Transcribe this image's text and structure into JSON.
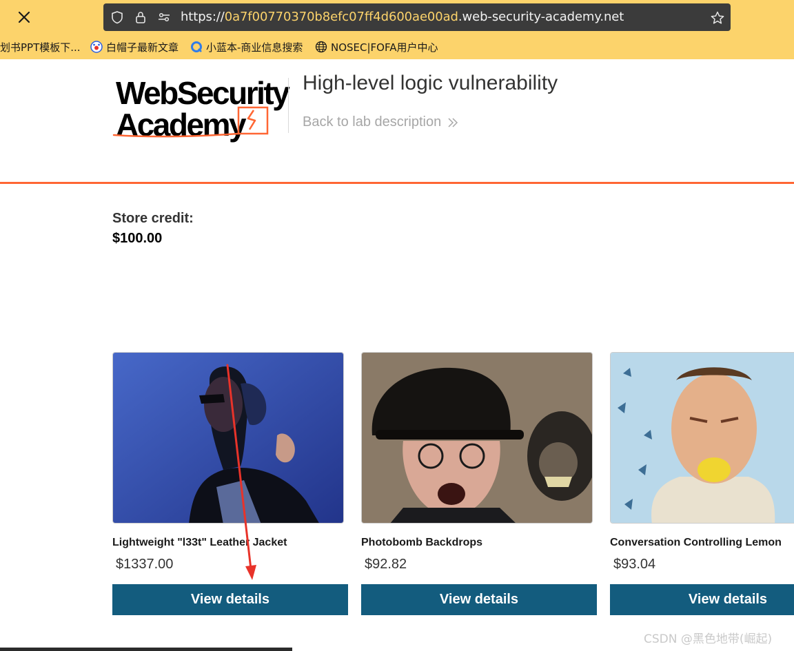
{
  "browser": {
    "url_prefix": "https://",
    "url_host_part": "0a7f00770370b8efc07ff4d600ae00ad",
    "url_suffix": ".web-security-academy.net",
    "bookmarks": [
      {
        "label": "划书PPT模板下...",
        "icon": "none"
      },
      {
        "label": "白帽子最新文章",
        "icon": "baidu-paw-icon"
      },
      {
        "label": "小蓝本-商业信息搜索",
        "icon": "blue-q-icon"
      },
      {
        "label": "NOSEC|FOFA用户中心",
        "icon": "globe-icon"
      }
    ]
  },
  "header": {
    "logo_line1": "WebSecurity",
    "logo_line2": "Academy",
    "lab_title": "High-level logic vulnerability",
    "back_link": "Back to lab description"
  },
  "store": {
    "credit_label": "Store credit:",
    "credit_value": "$100.00"
  },
  "products": [
    {
      "name": "Lightweight \"l33t\" Leather Jacket",
      "price": "$1337.00",
      "button": "View details",
      "image": "woman-headphones-jacket"
    },
    {
      "name": "Photobomb Backdrops",
      "price": "$92.82",
      "button": "View details",
      "image": "old-man-and-monkey"
    },
    {
      "name": "Conversation Controlling Lemon",
      "price": "$93.04",
      "button": "View details",
      "image": "man-lemon-in-mouth"
    }
  ],
  "watermark": "CSDN @黑色地带(崛起)",
  "colors": {
    "browser_bar": "#fcd36b",
    "accent_orange": "#ff6633",
    "button_blue": "#135c7e",
    "annotation_red": "#e8332a"
  }
}
